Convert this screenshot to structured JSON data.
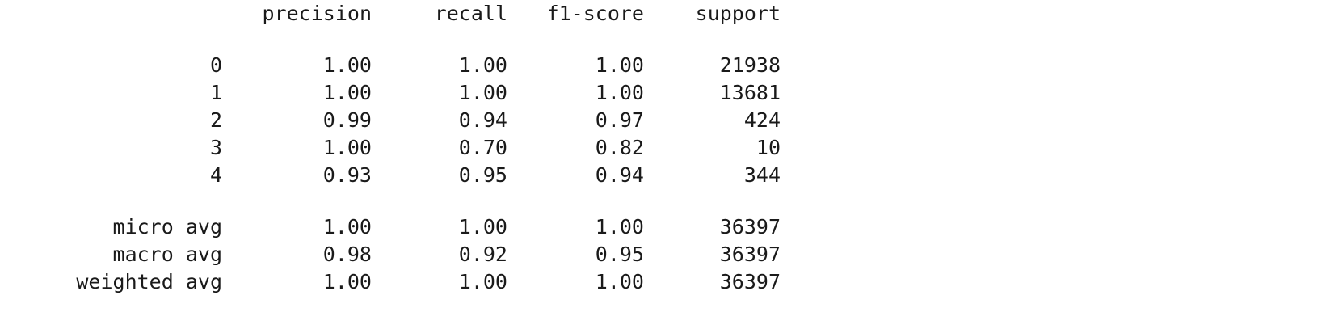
{
  "report": {
    "headers": [
      "precision",
      "recall",
      "f1-score",
      "support"
    ],
    "class_rows": [
      {
        "label": "0",
        "precision": "1.00",
        "recall": "1.00",
        "f1": "1.00",
        "support": "21938"
      },
      {
        "label": "1",
        "precision": "1.00",
        "recall": "1.00",
        "f1": "1.00",
        "support": "13681"
      },
      {
        "label": "2",
        "precision": "0.99",
        "recall": "0.94",
        "f1": "0.97",
        "support": "424"
      },
      {
        "label": "3",
        "precision": "1.00",
        "recall": "0.70",
        "f1": "0.82",
        "support": "10"
      },
      {
        "label": "4",
        "precision": "0.93",
        "recall": "0.95",
        "f1": "0.94",
        "support": "344"
      }
    ],
    "avg_rows": [
      {
        "label": "micro avg",
        "precision": "1.00",
        "recall": "1.00",
        "f1": "1.00",
        "support": "36397"
      },
      {
        "label": "macro avg",
        "precision": "0.98",
        "recall": "0.92",
        "f1": "0.95",
        "support": "36397"
      },
      {
        "label": "weighted avg",
        "precision": "1.00",
        "recall": "1.00",
        "f1": "1.00",
        "support": "36397"
      }
    ]
  }
}
